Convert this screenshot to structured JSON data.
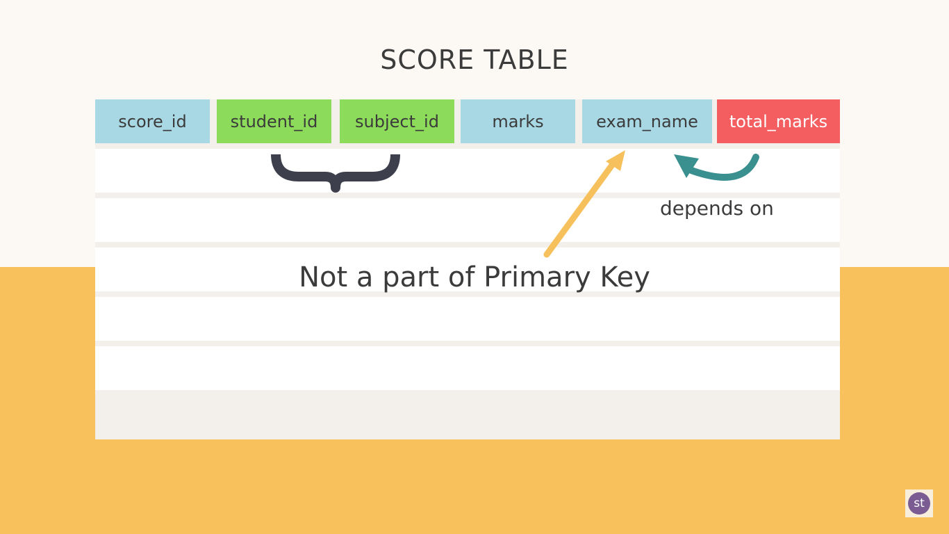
{
  "title": "SCORE TABLE",
  "columns": [
    {
      "label": "score_id",
      "color": "#a9d8e5",
      "text_color": "#3b3b3b"
    },
    {
      "label": "student_id",
      "color": "#8ddb5a",
      "text_color": "#3b3b3b"
    },
    {
      "label": "subject_id",
      "color": "#8ddb5a",
      "text_color": "#3b3b3b"
    },
    {
      "label": "marks",
      "color": "#a9d8e5",
      "text_color": "#3b3b3b"
    },
    {
      "label": "exam_name",
      "color": "#a9d8e5",
      "text_color": "#3b3b3b"
    },
    {
      "label": "total_marks",
      "color": "#f45e60",
      "text_color": "#ffffff"
    }
  ],
  "annotations": {
    "depends_on": "depends on",
    "not_primary_key": "Not a part of Primary Key"
  },
  "badge": {
    "text": "st",
    "color": "#7a5c93"
  },
  "colors": {
    "background_top": "#fcf9f4",
    "background_bottom": "#f8c15c",
    "brace": "#3d3f4c",
    "arrow_yellow": "#f6c15d",
    "arrow_teal": "#3a8f8f"
  }
}
